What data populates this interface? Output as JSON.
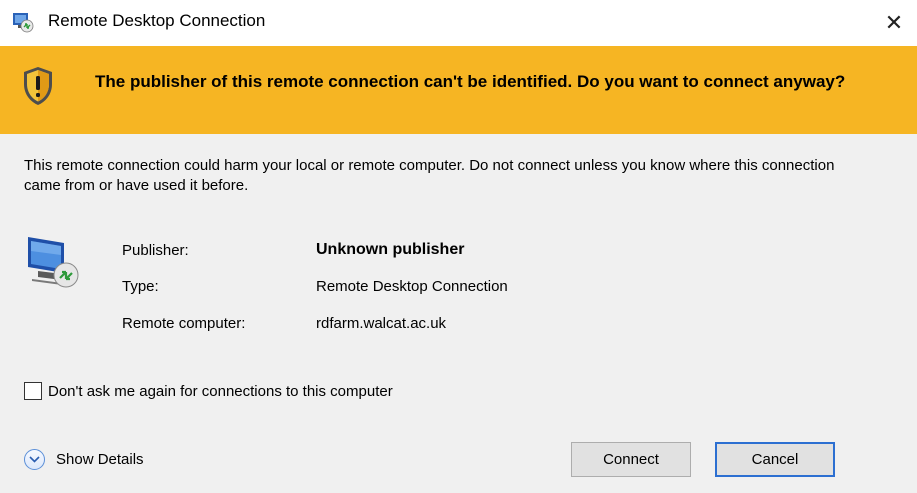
{
  "window": {
    "title": "Remote Desktop Connection",
    "close_glyph": "✕"
  },
  "warning": {
    "text": "The publisher of this remote connection can't be identified. Do you want to connect anyway?",
    "color": "#f6b523"
  },
  "description": "This remote connection could harm your local or remote computer. Do not connect unless you know where this connection came from or have used it before.",
  "info": {
    "publisher_label": "Publisher:",
    "publisher_value": "Unknown publisher",
    "type_label": "Type:",
    "type_value": "Remote Desktop Connection",
    "remote_label": "Remote computer:",
    "remote_value": "rdfarm.walcat.ac.uk"
  },
  "checkbox": {
    "label": "Don't ask me again for connections to this computer",
    "checked": false
  },
  "details": {
    "label": "Show Details"
  },
  "buttons": {
    "connect": "Connect",
    "cancel": "Cancel"
  },
  "icons": {
    "app": "remote-desktop-icon",
    "warning": "warning-shield-icon",
    "computer": "remote-computer-icon",
    "expand": "chevron-down-icon"
  }
}
